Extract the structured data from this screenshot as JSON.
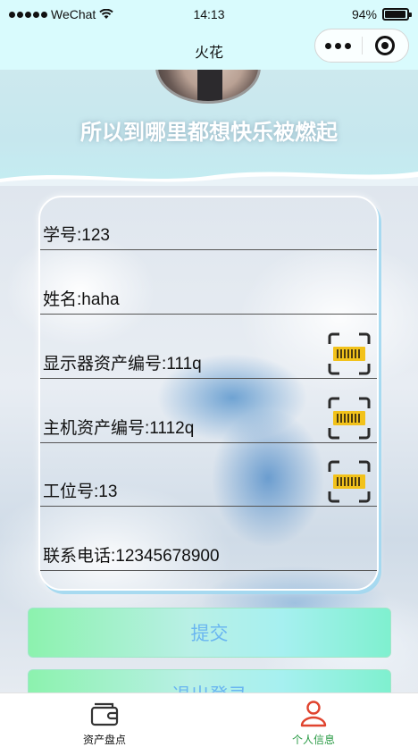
{
  "status_bar": {
    "carrier": "WeChat",
    "time": "14:13",
    "battery_percent": "94%",
    "battery_level": 0.94
  },
  "nav": {
    "title": "火花"
  },
  "header": {
    "motto": "所以到哪里都想快乐被燃起"
  },
  "form": {
    "fields": [
      {
        "label": "学号:123",
        "scan": false
      },
      {
        "label": "姓名:haha",
        "scan": false
      },
      {
        "label": "显示器资产编号:111q",
        "scan": true,
        "icon": "barcode-scan-icon"
      },
      {
        "label": "主机资产编号:1112q",
        "scan": true,
        "icon": "barcode-scan-icon"
      },
      {
        "label": "工位号:13",
        "scan": true,
        "icon": "barcode-scan-icon"
      },
      {
        "label": "联系电话:12345678900",
        "scan": false
      }
    ]
  },
  "buttons": {
    "submit": "提交",
    "logout": "退出登录"
  },
  "tab_bar": {
    "items": [
      {
        "label": "资产盘点",
        "icon": "wallet-icon",
        "active": false
      },
      {
        "label": "个人信息",
        "icon": "person-icon",
        "active": true
      }
    ]
  },
  "colors": {
    "header_bg": "#d9fbfd",
    "active_tab": "#2a9b45",
    "active_icon": "#e0442f",
    "button_text": "#6ab6f0",
    "scan_icon_yellow": "#f2c21b"
  }
}
